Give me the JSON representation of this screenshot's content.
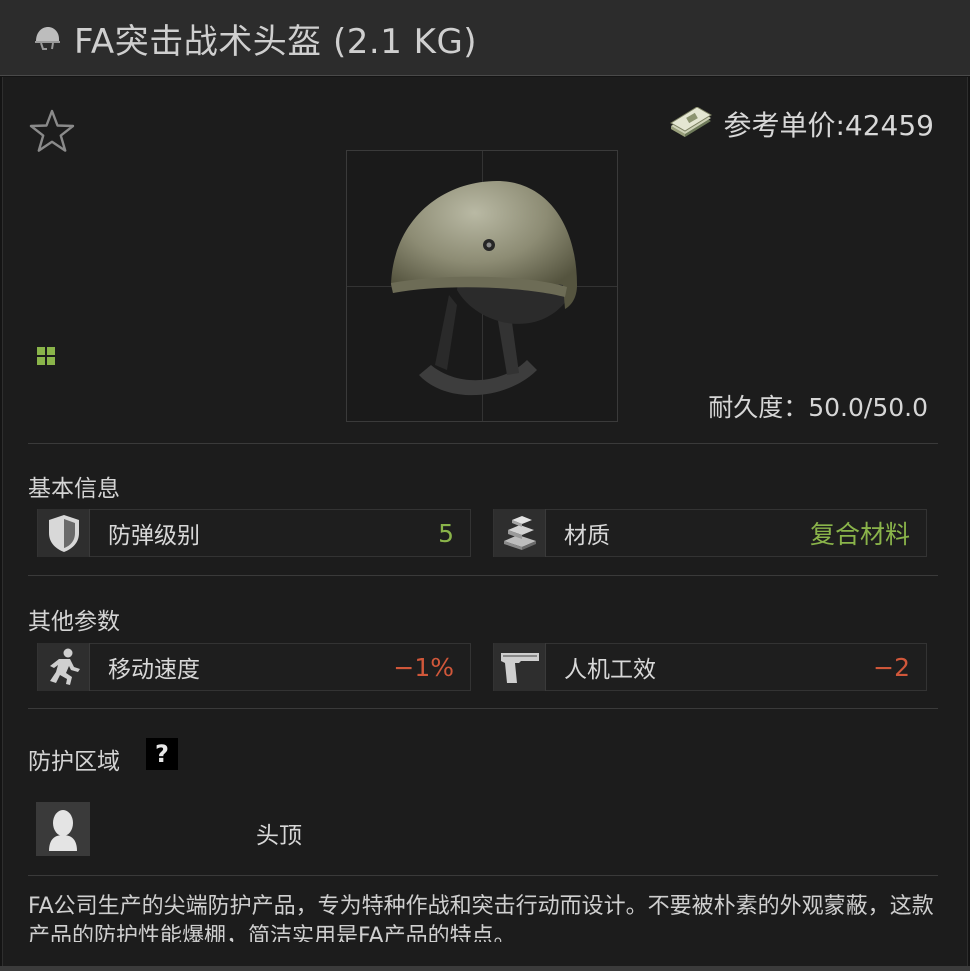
{
  "header": {
    "title": "FA突击战术头盔 (2.1 KG)",
    "icon": "helmet-icon"
  },
  "price": {
    "label": "参考单价:42459",
    "icon": "money-stack-icon"
  },
  "item": {
    "image": "helmet-image",
    "durability": "耐久度：50.0/50.0",
    "size_icon": "grid-icon",
    "favorite_icon": "star-icon"
  },
  "basic_info": {
    "title": "基本信息",
    "stats": [
      {
        "label": "防弹级别",
        "value": "5",
        "icon": "shield-icon",
        "value_color": "#8ab44a"
      },
      {
        "label": "材质",
        "value": "复合材料",
        "icon": "bars-icon",
        "value_color": "#8ab44a"
      }
    ]
  },
  "other_params": {
    "title": "其他参数",
    "stats": [
      {
        "label": "移动速度",
        "value": "−1%",
        "icon": "runner-icon",
        "value_color": "#d0573a"
      },
      {
        "label": "人机工效",
        "value": "−2",
        "icon": "pistol-icon",
        "value_color": "#d0573a"
      }
    ]
  },
  "protection": {
    "title": "防护区域",
    "help": "?",
    "zone": "头顶",
    "zone_icon": "head-silhouette-icon"
  },
  "description": "FA公司生产的尖端防护产品，专为特种作战和突击行动而设计。不要被朴素的外观蒙蔽，这款产品的防护性能爆棚，简洁实用是FA产品的特点。"
}
